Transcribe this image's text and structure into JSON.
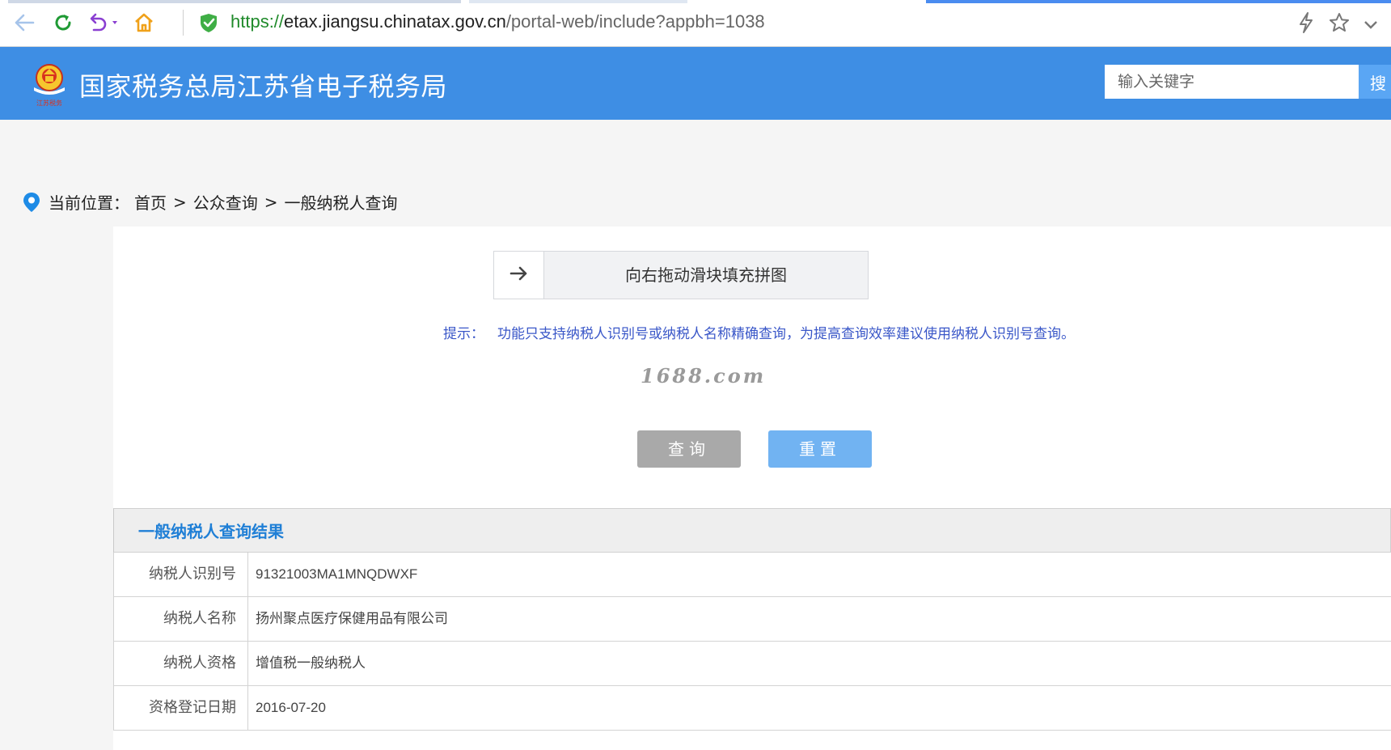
{
  "browser": {
    "url_scheme": "https://",
    "url_host": "etax.jiangsu.chinatax.gov.cn",
    "url_path": "/portal-web/include?appbh=1038"
  },
  "header": {
    "title": "国家税务总局江苏省电子税务局",
    "logo_caption": "江苏税务",
    "search_placeholder": "输入关键字",
    "search_button": "搜"
  },
  "breadcrumb": {
    "label": "当前位置：",
    "items": [
      "首页",
      "公众查询",
      "一般纳税人查询"
    ],
    "separator": ">"
  },
  "form": {
    "slider_label": "向右拖动滑块填充拼图",
    "hint_label": "提示：",
    "hint_text": "功能只支持纳税人识别号或纳税人名称精确查询，为提高查询效率建议使用纳税人识别号查询。",
    "watermark": "1688.com",
    "query_button": "查询",
    "reset_button": "重置"
  },
  "result": {
    "title": "一般纳税人查询结果",
    "rows": [
      {
        "label": "纳税人识别号",
        "value": "91321003MA1MNQDWXF"
      },
      {
        "label": "纳税人名称",
        "value": "扬州聚点医疗保健用品有限公司"
      },
      {
        "label": "纳税人资格",
        "value": "增值税一般纳税人"
      },
      {
        "label": "资格登记日期",
        "value": "2016-07-20"
      }
    ]
  },
  "colors": {
    "header_blue": "#3e8ee4",
    "result_title": "#1f7fd6",
    "hint": "#3a57c8"
  }
}
